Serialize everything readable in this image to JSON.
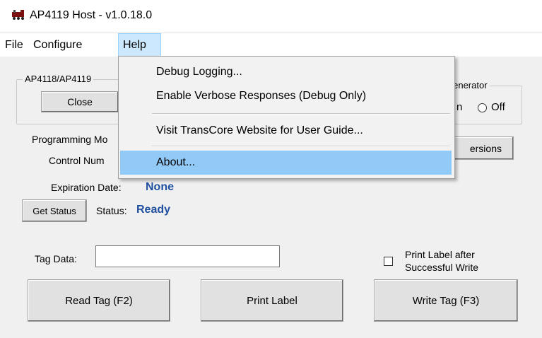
{
  "window": {
    "title": "AP4119 Host - v1.0.18.0",
    "icon": "train-icon"
  },
  "menubar": {
    "items": [
      {
        "label": "File"
      },
      {
        "label": "Configure"
      },
      {
        "label": "Help",
        "active": true
      }
    ]
  },
  "help_menu": {
    "items": [
      {
        "label": "Debug Logging..."
      },
      {
        "label": "Enable Verbose Responses (Debug Only)"
      },
      {
        "label": "Visit TransCore Website for User Guide..."
      },
      {
        "label": "About...",
        "highlighted": true
      }
    ]
  },
  "reader_group": {
    "caption": "AP4118/AP4119",
    "close_label": "Close"
  },
  "generator_group": {
    "caption": "Generator",
    "on_label_fragment": "n",
    "off_label": "Off",
    "selected": "none"
  },
  "versions_button": {
    "label": "ersions"
  },
  "info": {
    "programming_mode_label": "Programming Mo",
    "control_number_label": "Control Num",
    "expiration_label": "Expiration Date:",
    "expiration_value": "None",
    "get_status_label": "Get Status",
    "status_label": "Status:",
    "status_value": "Ready"
  },
  "tag": {
    "tag_data_label": "Tag Data:",
    "tag_data_value": "",
    "print_after_write_label_line1": "Print Label after",
    "print_after_write_label_line2": "Successful Write",
    "print_after_write_checked": false
  },
  "actions": {
    "read_label": "Read Tag (F2)",
    "print_label": "Print Label",
    "write_label": "Write Tag (F3)"
  },
  "colors": {
    "status_value": "#1f4fa0",
    "menu_highlight": "#91c9f7",
    "menubar_active": "#cce8ff"
  }
}
